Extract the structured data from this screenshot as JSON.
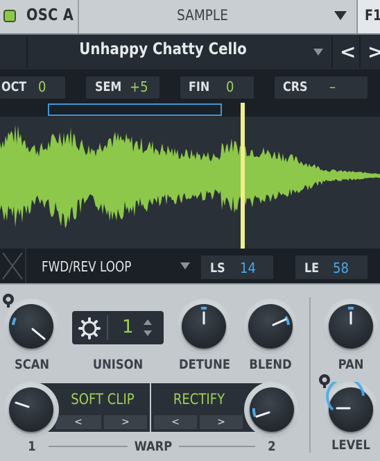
{
  "header": {
    "osc_label": "OSC A",
    "osc_enabled": true,
    "sample_type": "SAMPLE",
    "filter_tab": "F1"
  },
  "sample": {
    "name": "Unhappy Chatty Cello",
    "prev_label": "<",
    "next_label": ">"
  },
  "pitch": {
    "oct": {
      "label": "OCT",
      "value": "0"
    },
    "sem": {
      "label": "SEM",
      "value": "+5"
    },
    "fin": {
      "label": "FIN",
      "value": "0"
    },
    "crs": {
      "label": "CRS",
      "value": "–"
    }
  },
  "loop": {
    "mode": "FWD/REV LOOP",
    "ls": {
      "label": "LS",
      "value": "14"
    },
    "le": {
      "label": "LE",
      "value": "58"
    }
  },
  "knobs": {
    "scan": "SCAN",
    "unison": "UNISON",
    "unison_value": "1",
    "detune": "DETUNE",
    "blend": "BLEND",
    "pan": "PAN",
    "level": "LEVEL"
  },
  "warp": {
    "label": "WARP",
    "slot1": "SOFT CLIP",
    "slot2": "RECTIFY",
    "knob1_label": "1",
    "knob2_label": "2",
    "prev": "<",
    "next": ">"
  },
  "colors": {
    "accent_green": "#9fd15a",
    "accent_blue": "#4aa8e8",
    "waveform": "#8dc84a",
    "playhead": "#f0ee8a"
  }
}
